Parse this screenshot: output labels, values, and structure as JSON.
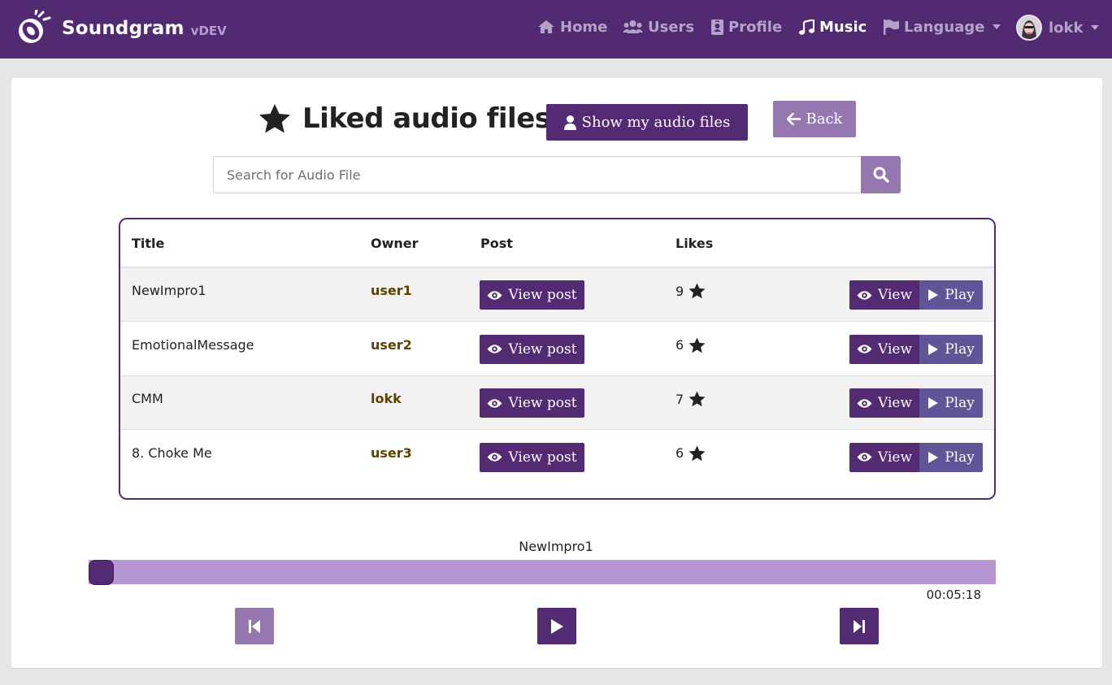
{
  "navbar": {
    "brand_name": "Soundgram",
    "brand_version": "vDEV",
    "items": [
      {
        "label": "Home",
        "icon": "home-icon"
      },
      {
        "label": "Users",
        "icon": "users-icon"
      },
      {
        "label": "Profile",
        "icon": "id-card-icon"
      },
      {
        "label": "Music",
        "icon": "music-icon",
        "active": true
      },
      {
        "label": "Language",
        "icon": "flag-icon",
        "dropdown": true
      }
    ],
    "user": {
      "name": "lokk",
      "icon": "avatar"
    }
  },
  "page": {
    "title": "Liked audio files",
    "title_icon": "star-icon",
    "show_my_files_label": "Show my audio files",
    "back_label": "Back",
    "search_placeholder": "Search for Audio File",
    "search_value": ""
  },
  "table": {
    "headers": [
      "Title",
      "Owner",
      "Post",
      "Likes"
    ],
    "view_post_label": "View post",
    "view_label": "View",
    "play_label": "Play",
    "rows": [
      {
        "title": "NewImpro1",
        "owner": "user1",
        "likes": "9"
      },
      {
        "title": "EmotionalMessage",
        "owner": "user2",
        "likes": "6"
      },
      {
        "title": "CMM",
        "owner": "lokk",
        "likes": "7"
      },
      {
        "title": "8. Choke Me",
        "owner": "user3",
        "likes": "6"
      }
    ]
  },
  "player": {
    "track_title": "NewImpro1",
    "time": "00:05:18",
    "progress": 0,
    "controls": [
      "previous-icon",
      "play-icon",
      "next-icon"
    ]
  },
  "colors": {
    "primary": "#532b73",
    "primary_light": "#9578b0",
    "progress_track": "#b797d3",
    "play_button": "#5f5597"
  }
}
